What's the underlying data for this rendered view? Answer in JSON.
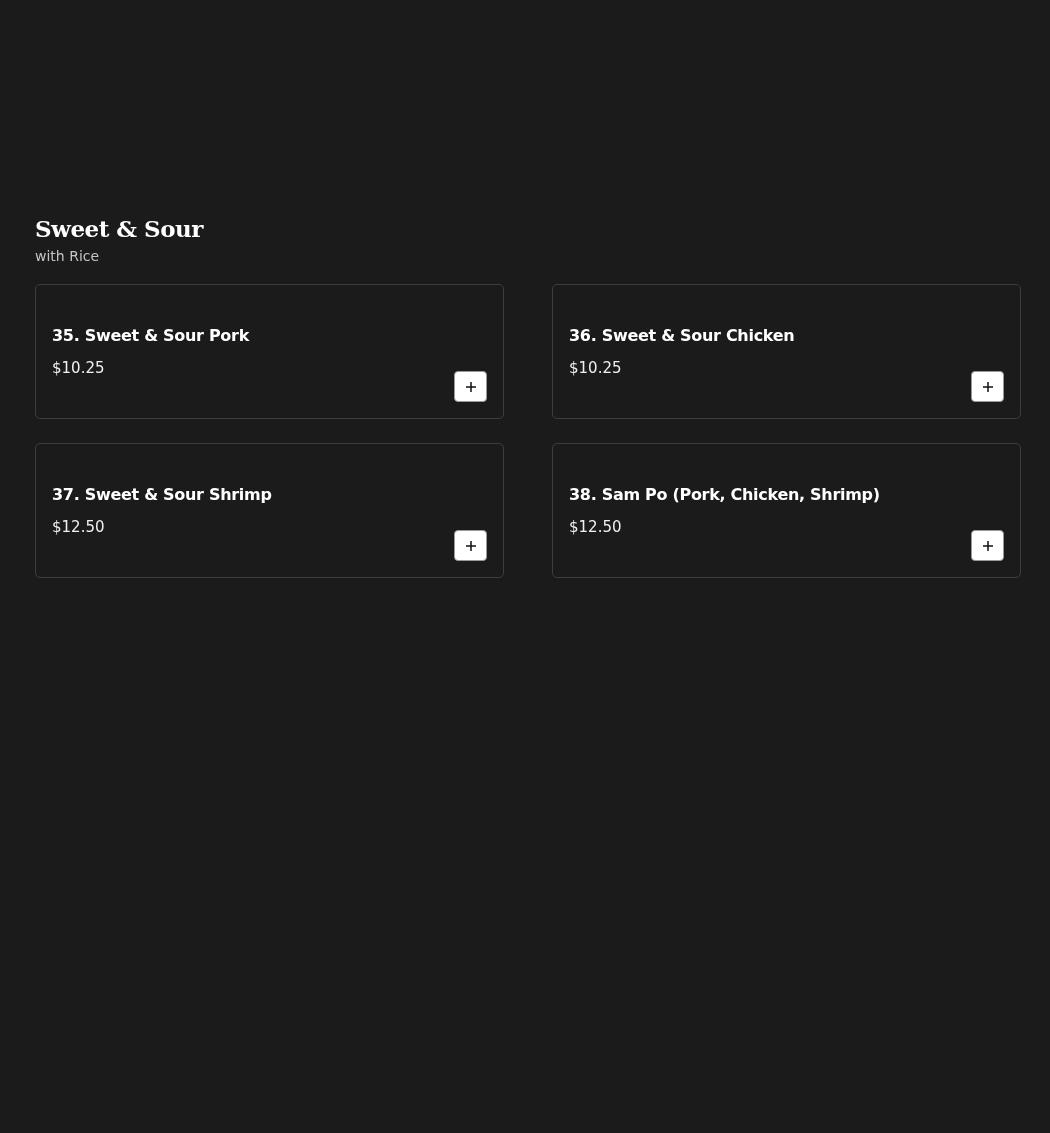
{
  "section": {
    "title": "Sweet & Sour",
    "subtitle": "with Rice"
  },
  "items": [
    {
      "name": "35. Sweet & Sour Pork",
      "price": "$10.25"
    },
    {
      "name": "36. Sweet & Sour Chicken",
      "price": "$10.25"
    },
    {
      "name": "37. Sweet & Sour Shrimp",
      "price": "$12.50"
    },
    {
      "name": "38. Sam Po (Pork, Chicken, Shrimp)",
      "price": "$12.50"
    }
  ]
}
